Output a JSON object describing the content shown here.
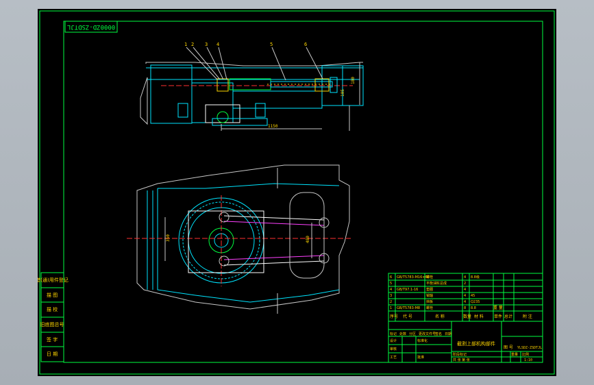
{
  "drawing": {
    "code_stamp": "0000ZD-ZSDTJL",
    "part_callouts": [
      "1",
      "2",
      "3",
      "4",
      "5",
      "6"
    ],
    "dimensions": {
      "top_right_vertical_1": "180",
      "top_right_vertical_2": "105",
      "top_horizontal": "1150",
      "plan_left_vertical": "350",
      "plan_right_vertical": "480"
    },
    "left_side_table": [
      "借(通)用件登记",
      "描 图",
      "描 校",
      "旧底图总号",
      "签 字",
      "日 期"
    ],
    "bom_header": [
      "序号",
      "代 号",
      "名 称",
      "数量",
      "材 料",
      "单件",
      "总计",
      "重 量",
      "附 注"
    ],
    "bom_rows": [
      [
        "6",
        "GB/T5783-M16×60",
        "螺栓",
        "4",
        "8.8级",
        "",
        "",
        ""
      ],
      [
        "5",
        "",
        "平衡油缸总成",
        "2",
        "",
        "",
        "",
        ""
      ],
      [
        "4",
        "GB/T97.1-16",
        "垫圈",
        "4",
        "",
        "",
        "",
        ""
      ],
      [
        "3",
        "",
        "销轴",
        "4",
        "45",
        "",
        "",
        ""
      ],
      [
        "2",
        "",
        "挡板",
        "4",
        "Q235",
        "",
        "",
        ""
      ],
      [
        "1",
        "GB/T5783-M8",
        "螺栓",
        "8",
        "8.8",
        "",
        "",
        ""
      ]
    ],
    "title_block": {
      "drawing_title": "截割上部机构部件",
      "drawing_number_label": "图 号",
      "drawing_number": "YLSDZ-ZSDTJL",
      "stage_label": "阶段标记",
      "weight_label": "重量",
      "scale_label": "比例",
      "sheet_label": "共 张 第 张",
      "scale_value": "1:10",
      "roles": [
        "设计",
        "审核",
        "工艺",
        "标准化",
        "批准"
      ],
      "revision_headers": [
        "标记",
        "处数",
        "分区",
        "更改文件号",
        "签名",
        "日期"
      ]
    }
  }
}
